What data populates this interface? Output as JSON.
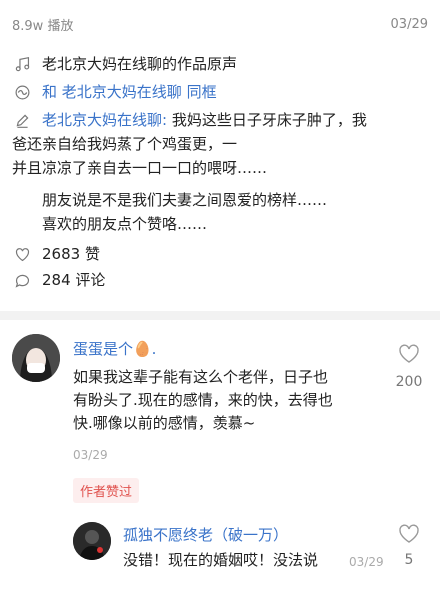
{
  "post": {
    "plays": "8.9w 播放",
    "date": "03/29",
    "sound_label": "老北京大妈在线聊的作品原声",
    "duet_prefix": "和",
    "duet_user": "老北京大妈在线聊",
    "duet_suffix": "同框",
    "author_label": "老北京大妈在线聊:",
    "caption": [
      "我妈这些日子牙床子肿了，我",
      "爸还亲自给我妈蒸了个鸡蛋更，一",
      "并且凉凉了亲自去一口一口的喂呀……",
      "朋友说是不是我们夫妻之间恩爱的榜样……",
      " 喜欢的朋友点个赞咯……"
    ],
    "likes": "2683 赞",
    "comments": "284 评论"
  },
  "comments": [
    {
      "name": "蛋蛋是个🥚.",
      "text": [
        "如果我这辈子能有这么个老伴，日子也",
        "有盼头了.现在的感情，来的快，去得也",
        "快.哪像以前的感情，羡慕~"
      ],
      "time": "03/29",
      "likes": "200",
      "author_liked": "作者赞过"
    },
    {
      "name": "孤独不愿终老（破一万）",
      "text": "没错！现在的婚姻哎！没法说",
      "time": "03/29",
      "likes": "5"
    }
  ],
  "icons": [
    "music-note-icon",
    "duet-icon",
    "pencil-icon",
    "heart-icon",
    "comment-icon"
  ],
  "colors": {
    "link": "#3a73c9",
    "badge": "#e0524e",
    "muted": "#888888"
  }
}
